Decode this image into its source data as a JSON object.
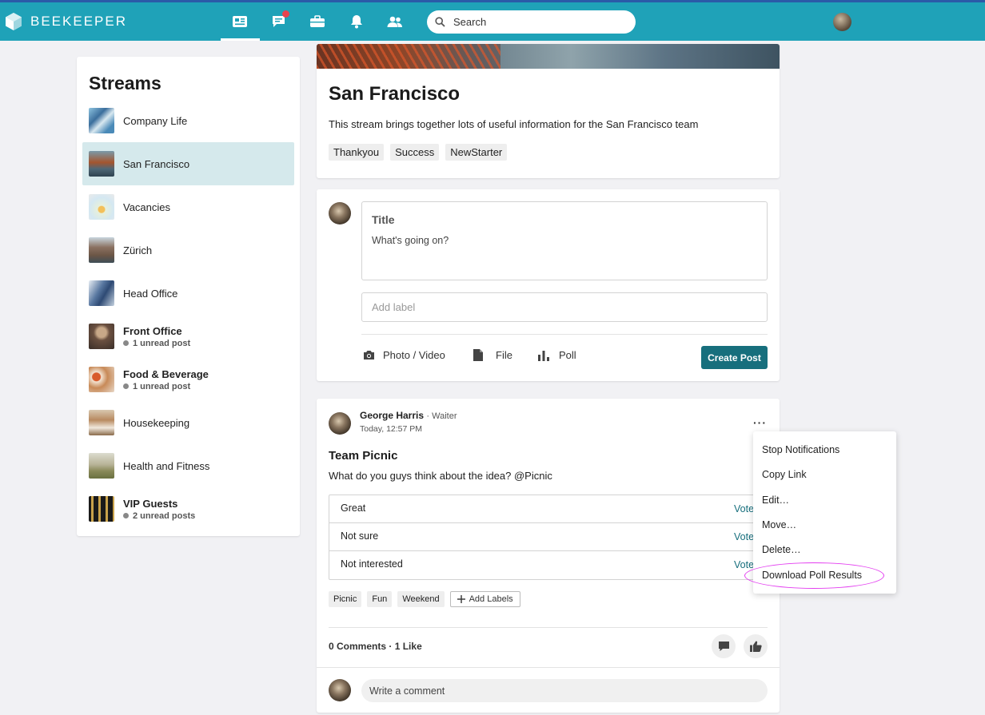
{
  "app": {
    "brand": "BEEKEEPER"
  },
  "search": {
    "placeholder": "Search"
  },
  "streams": {
    "title": "Streams",
    "items": [
      {
        "name": "Company Life",
        "unread": ""
      },
      {
        "name": "San Francisco",
        "unread": ""
      },
      {
        "name": "Vacancies",
        "unread": ""
      },
      {
        "name": "Zürich",
        "unread": ""
      },
      {
        "name": "Head Office",
        "unread": ""
      },
      {
        "name": "Front Office",
        "unread": "1 unread post"
      },
      {
        "name": "Food & Beverage",
        "unread": "1 unread post"
      },
      {
        "name": "Housekeeping",
        "unread": ""
      },
      {
        "name": "Health and Fitness",
        "unread": ""
      },
      {
        "name": "VIP Guests",
        "unread": "2 unread posts"
      }
    ]
  },
  "header": {
    "title": "San Francisco",
    "description": "This stream brings together lots of useful information for the San Francisco team",
    "tags": [
      "Thankyou",
      "Success",
      "NewStarter"
    ]
  },
  "composer": {
    "title": "Title",
    "body_placeholder": "What's going on?",
    "label_placeholder": "Add label",
    "photo_label": "Photo / Video",
    "file_label": "File",
    "poll_label": "Poll",
    "create_label": "Create Post"
  },
  "post": {
    "author": "George Harris",
    "role": "Waiter",
    "time": "Today, 12:57 PM",
    "more": "···",
    "title": "Team Picnic",
    "body": "What do you guys think about the idea? @Picnic",
    "poll_options": [
      {
        "label": "Great",
        "vote": "Vote"
      },
      {
        "label": "Not sure",
        "vote": "Vote"
      },
      {
        "label": "Not interested",
        "vote": "Vote"
      }
    ],
    "tags": [
      "Picnic",
      "Fun",
      "Weekend"
    ],
    "add_labels": "Add Labels",
    "comments": "0 Comments",
    "likes": "1 Like",
    "comment_placeholder": "Write a comment"
  },
  "menu": {
    "items": [
      "Stop Notifications",
      "Copy Link",
      "Edit…",
      "Move…",
      "Delete…",
      "Download Poll Results"
    ]
  },
  "colors": {
    "topbar": "#1fa2b8",
    "accent": "#176f7d",
    "highlight": "#e33ef0"
  }
}
